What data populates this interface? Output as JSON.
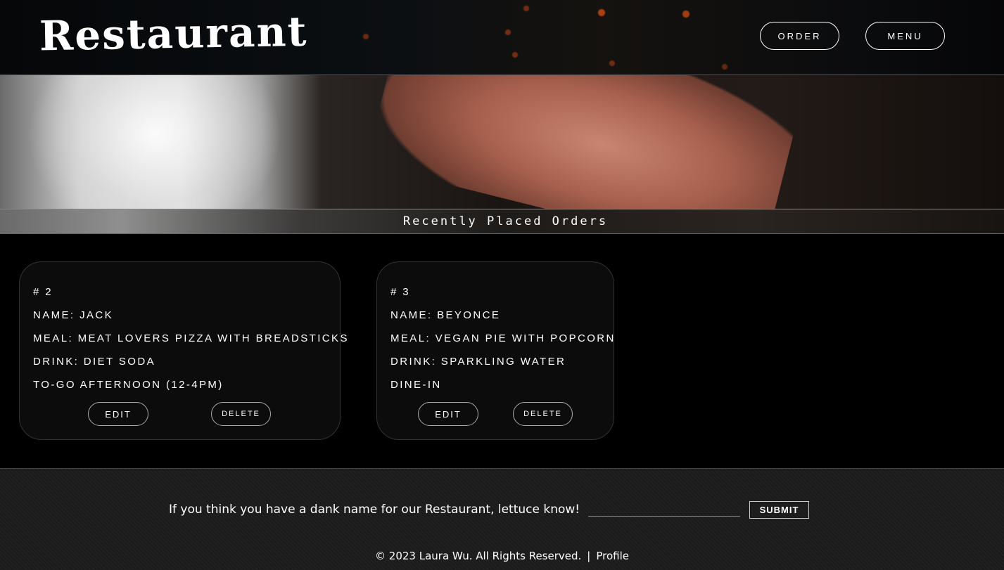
{
  "header": {
    "logo": "Restaurant",
    "nav": [
      {
        "label": "ORDER"
      },
      {
        "label": "MENU"
      }
    ]
  },
  "hero": {
    "banner_title": "Recently Placed Orders"
  },
  "orders": [
    {
      "number": "# 2",
      "name": "NAME: JACK",
      "meal": "MEAL: MEAT LOVERS PIZZA WITH BREADSTICKS",
      "drink": "DRINK: DIET SODA",
      "service": "TO-GO AFTERNOON (12-4PM)",
      "edit_label": "EDIT",
      "delete_label": "DELETE"
    },
    {
      "number": "# 3",
      "name": "NAME: BEYONCE",
      "meal": "MEAL: VEGAN PIE WITH POPCORN",
      "drink": "DRINK: SPARKLING WATER",
      "service": "DINE-IN",
      "edit_label": "EDIT",
      "delete_label": "DELETE"
    }
  ],
  "footer": {
    "prompt": "If you think you have a dank name for our Restaurant, lettuce know!",
    "input_value": "",
    "input_placeholder": "",
    "submit_label": "SUBMIT",
    "copyright": "© 2023 Laura Wu. All Rights Reserved.",
    "separator": "|",
    "profile_label": "Profile"
  }
}
